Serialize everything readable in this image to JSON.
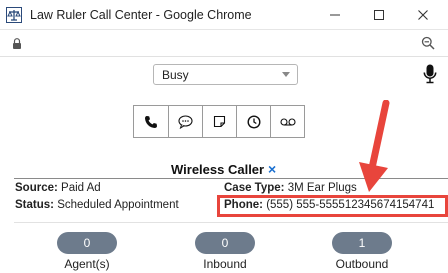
{
  "window": {
    "title": "Law Ruler Call Center - Google Chrome",
    "app_icon": "law-ruler-scales-icon",
    "controls": [
      "minimize-icon",
      "maximize-icon",
      "close-icon"
    ]
  },
  "address_bar": {
    "left_icon": "lock-icon",
    "right_icon": "zoom-out-icon"
  },
  "status": {
    "selected": "Busy"
  },
  "microphone_icon": "microphone-icon",
  "toolbar": {
    "buttons": [
      "phone-icon",
      "chat-icon",
      "note-icon",
      "clock-icon",
      "voicemail-icon"
    ]
  },
  "caller": {
    "name": "Wireless Caller",
    "close_glyph": "×",
    "source_label": "Source:",
    "source_value": "Paid Ad",
    "status_label": "Status:",
    "status_value": "Scheduled Appointment",
    "case_type_label": "Case Type:",
    "case_type_value": "3M Ear Plugs",
    "phone_label": "Phone:",
    "phone_value": "(555) 555-555512345674154741"
  },
  "counters": [
    {
      "value": "0",
      "label": "Agent(s)"
    },
    {
      "value": "0",
      "label": "Inbound"
    },
    {
      "value": "1",
      "label": "Outbound"
    }
  ],
  "colors": {
    "counter_bg": "#6d7b8c",
    "annotation_red": "#e8453c",
    "link_blue": "#1a6fd0"
  }
}
